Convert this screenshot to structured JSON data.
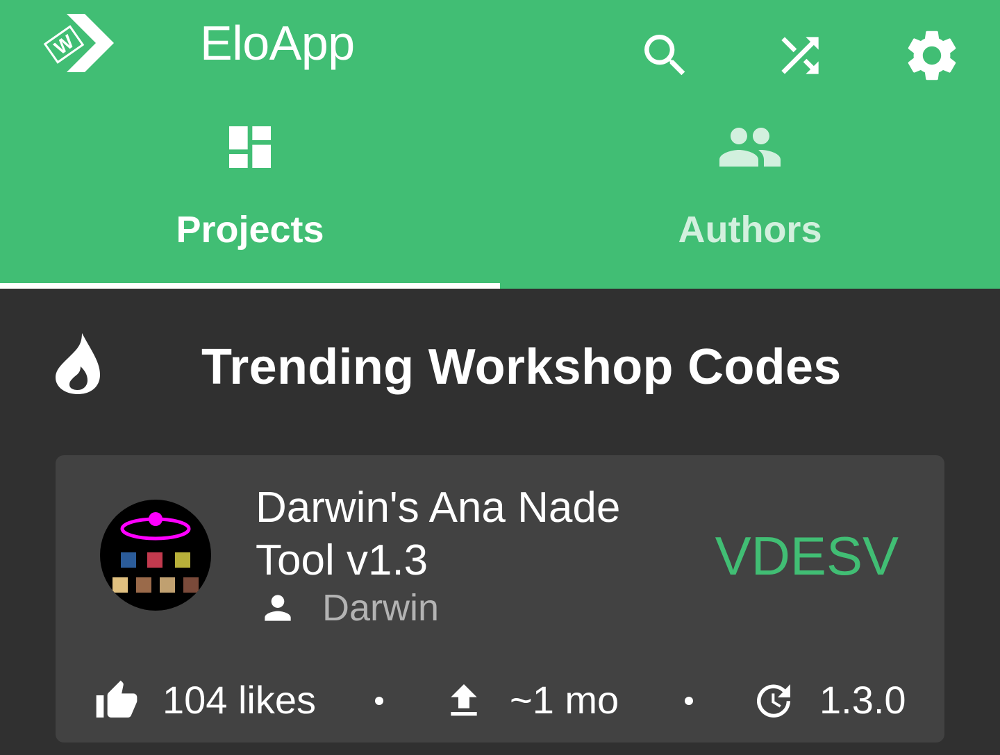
{
  "toolbar": {
    "title": "EloApp",
    "logo_icon": "workshop-logo-icon",
    "actions": [
      "search-icon",
      "shuffle-icon",
      "settings-gear-icon"
    ]
  },
  "tabs": [
    {
      "label": "Projects",
      "icon": "dashboard-icon",
      "selected": true
    },
    {
      "label": "Authors",
      "icon": "people-icon",
      "selected": false
    }
  ],
  "section": {
    "icon": "flame-icon",
    "title": "Trending Workshop Codes"
  },
  "card": {
    "title": "Darwin's Ana Nade Tool v1.3",
    "author": "Darwin",
    "code": "VDESV",
    "likes": "104 likes",
    "updated": "~1 mo",
    "version": "1.3.0"
  },
  "colors": {
    "accent": "#41be74",
    "background": "#303030",
    "card": "#424242",
    "avatar_ring": "#ff00ff"
  }
}
